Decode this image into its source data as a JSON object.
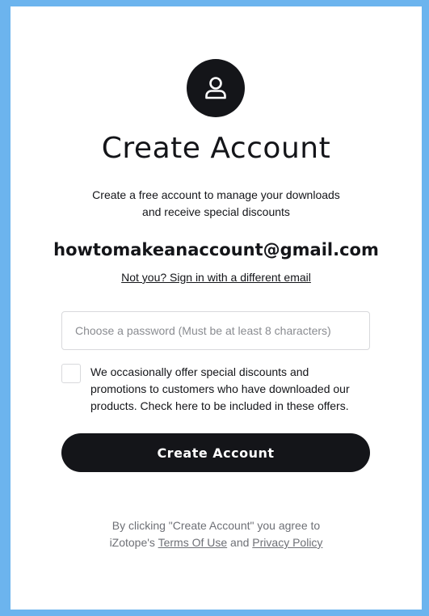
{
  "header": {
    "icon": "user-icon",
    "title": "Create Account",
    "subtitle_line1": "Create a free account to manage your downloads",
    "subtitle_line2": "and receive special discounts"
  },
  "account": {
    "email": "howtomakeanaccount@gmail.com",
    "switch_link": "Not you? Sign in with a different email"
  },
  "form": {
    "password_placeholder": "Choose a password (Must be at least 8 characters)",
    "password_value": "",
    "optin_checked": false,
    "optin_line1": "We occasionally offer special discounts and",
    "optin_line2": "promotions to customers who have downloaded our",
    "optin_line3": "products. Check here to be included in these offers.",
    "submit_label": "Create Account"
  },
  "legal": {
    "line1": "By clicking \"Create Account\" you agree to",
    "prefix": "iZotope's ",
    "terms_label": "Terms Of Use",
    "and": " and ",
    "privacy_label": "Privacy Policy"
  },
  "colors": {
    "background": "#6cb4ee",
    "card": "#ffffff",
    "primary": "#141519",
    "muted": "#6e7076",
    "border": "#d8d9dc"
  }
}
